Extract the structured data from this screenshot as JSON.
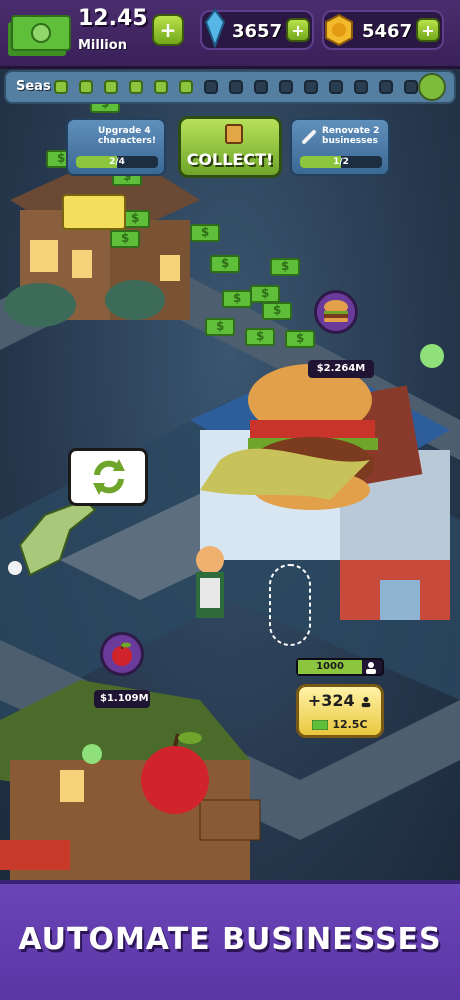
{
  "hud": {
    "money_value": "12.45",
    "money_unit": "Million",
    "gems": "3657",
    "coins": "5467",
    "plus": "+"
  },
  "season": {
    "label": "Seas",
    "dots_total": 15,
    "dots_filled": 6
  },
  "quests": [
    {
      "text": "Upgrade 4 characters!",
      "progress": "2/4"
    },
    {
      "text": "Renovate 2 businesses",
      "progress": "1/2"
    }
  ],
  "collect": {
    "label": "COLLECT!"
  },
  "burger_shop": {
    "value": "$2.264M"
  },
  "apple_shop": {
    "value": "$1.109M"
  },
  "upgrade": {
    "capacity": "1000",
    "hire_amount": "+324",
    "hire_cost": "12.5C"
  },
  "banner": {
    "title": "AUTOMATE BUSINESSES"
  },
  "colors": {
    "hud_purple": "#4a2d6e",
    "accent_green": "#8cc63f",
    "banner_purple": "#6a45b8"
  }
}
